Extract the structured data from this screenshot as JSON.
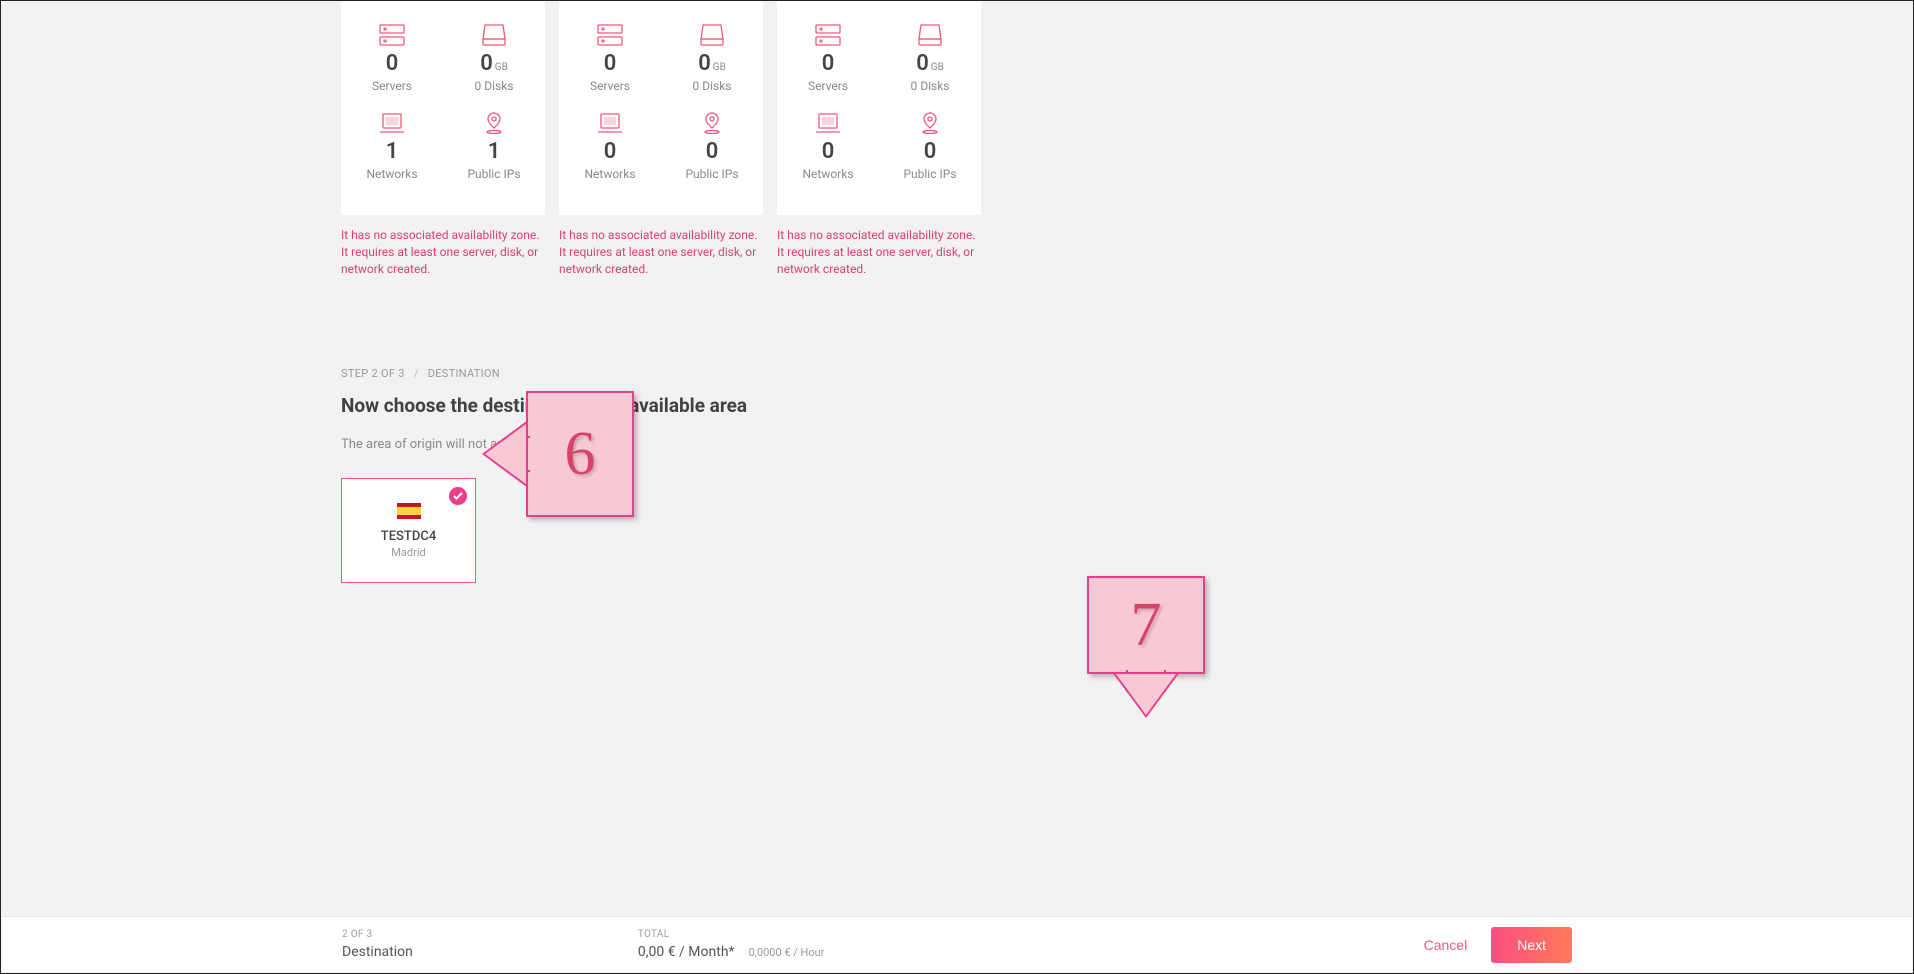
{
  "resource_cards": [
    {
      "servers": "0",
      "disks_value": "0",
      "disks_unit": "GB",
      "disks_sub": "0 Disks",
      "networks": "1",
      "public_ips": "1",
      "warning": "It has no associated availability zone. It requires at least one server, disk, or network created."
    },
    {
      "servers": "0",
      "disks_value": "0",
      "disks_unit": "GB",
      "disks_sub": "0 Disks",
      "networks": "0",
      "public_ips": "0",
      "warning": "It has no associated availability zone. It requires at least one server, disk, or network created."
    },
    {
      "servers": "0",
      "disks_value": "0",
      "disks_unit": "GB",
      "disks_sub": "0 Disks",
      "networks": "0",
      "public_ips": "0",
      "warning": "It has no associated availability zone. It requires at least one server, disk, or network created."
    }
  ],
  "labels": {
    "servers": "Servers",
    "disks": "0 Disks",
    "networks": "Networks",
    "public_ips": "Public IPs"
  },
  "step": {
    "breadcrumb_step": "STEP 2 OF 3",
    "breadcrumb_section": "DESTINATION",
    "title": "Now choose the destination in an available area",
    "subtitle": "The area of origin will not appear available"
  },
  "destination": {
    "name": "TESTDC4",
    "city": "Madrid"
  },
  "callouts": {
    "six": "6",
    "seven": "7"
  },
  "footer": {
    "step_label": "2 OF 3",
    "step_name": "Destination",
    "total_label": "TOTAL",
    "price_month": "0,00 € / Month*",
    "price_hour": "0,0000 € / Hour",
    "cancel": "Cancel",
    "next": "Next"
  }
}
